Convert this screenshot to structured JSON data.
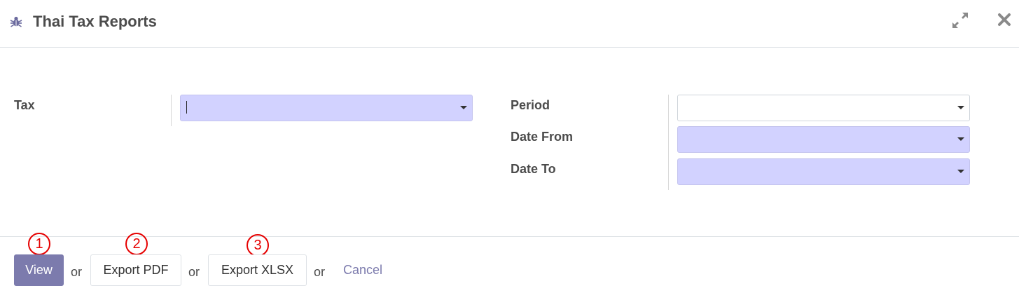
{
  "dialog": {
    "title": "Thai Tax Reports",
    "header_icon": "bug-icon",
    "expand_icon": "expand-icon",
    "close_icon": "close-icon"
  },
  "form": {
    "tax": {
      "label": "Tax",
      "value": ""
    },
    "period": {
      "label": "Period",
      "value": ""
    },
    "date_from": {
      "label": "Date From",
      "value": ""
    },
    "date_to": {
      "label": "Date To",
      "value": ""
    }
  },
  "footer": {
    "view_label": "View",
    "export_pdf_label": "Export PDF",
    "export_xlsx_label": "Export XLSX",
    "cancel_label": "Cancel",
    "or_label": "or",
    "annotations": [
      "1",
      "2",
      "3"
    ]
  },
  "colors": {
    "primary": "#7c7bad",
    "required_field": "#d2d2ff",
    "annotation": "#e60000"
  }
}
